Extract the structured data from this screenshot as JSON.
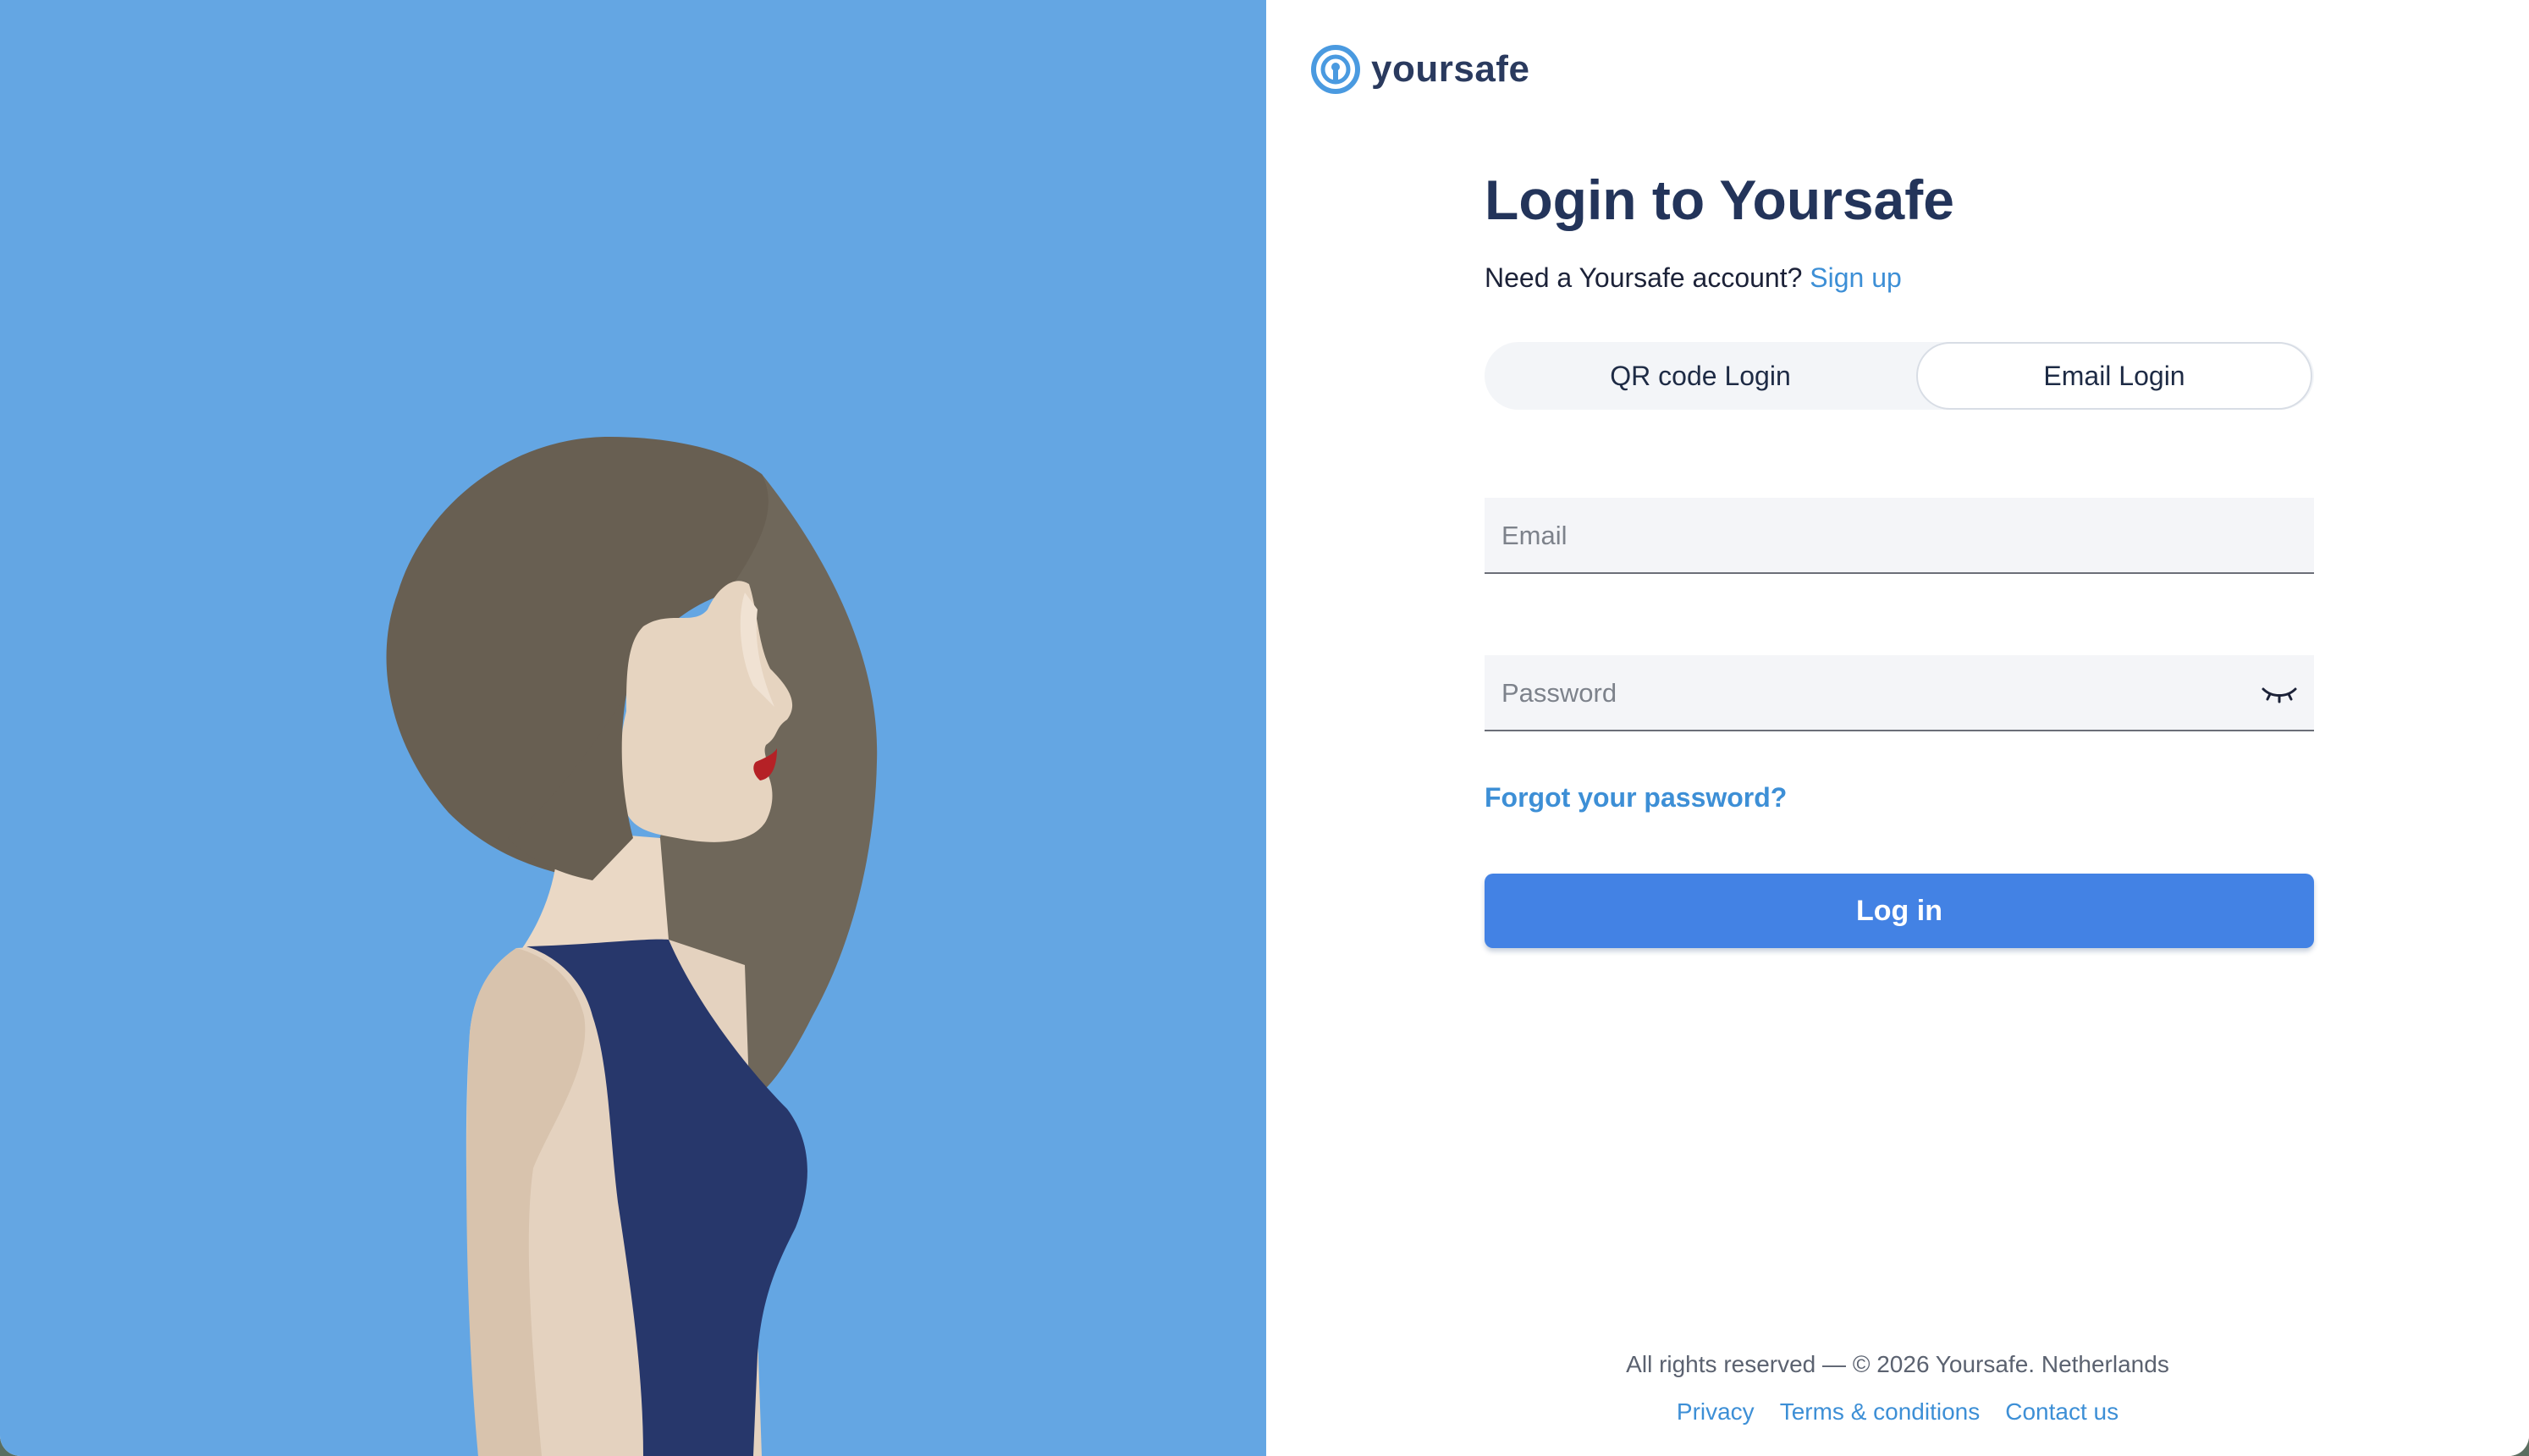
{
  "brand": {
    "name": "yoursafe",
    "logo_icon": "yoursafe-logo-icon",
    "primary_color": "#4382e4",
    "link_color": "#3d8fd6",
    "panel_color": "#64a6e3"
  },
  "login": {
    "title": "Login to Yoursafe",
    "signup_prompt": "Need a Yoursafe account?",
    "signup_link": "Sign up",
    "tabs": [
      {
        "label": "QR code Login",
        "selected": false
      },
      {
        "label": "Email Login",
        "selected": true
      }
    ],
    "email_placeholder": "Email",
    "email_value": "",
    "password_placeholder": "Password",
    "password_value": "",
    "password_toggle_icon": "eye-closed-icon",
    "forgot_password": "Forgot your password?",
    "submit_label": "Log in"
  },
  "footer": {
    "copyright": "All rights reserved — © 2026 Yoursafe. Netherlands",
    "links": [
      "Privacy",
      "Terms & conditions",
      "Contact us"
    ]
  },
  "illustration": "woman-profile-illustration",
  "highlight_color": "#e0422c"
}
